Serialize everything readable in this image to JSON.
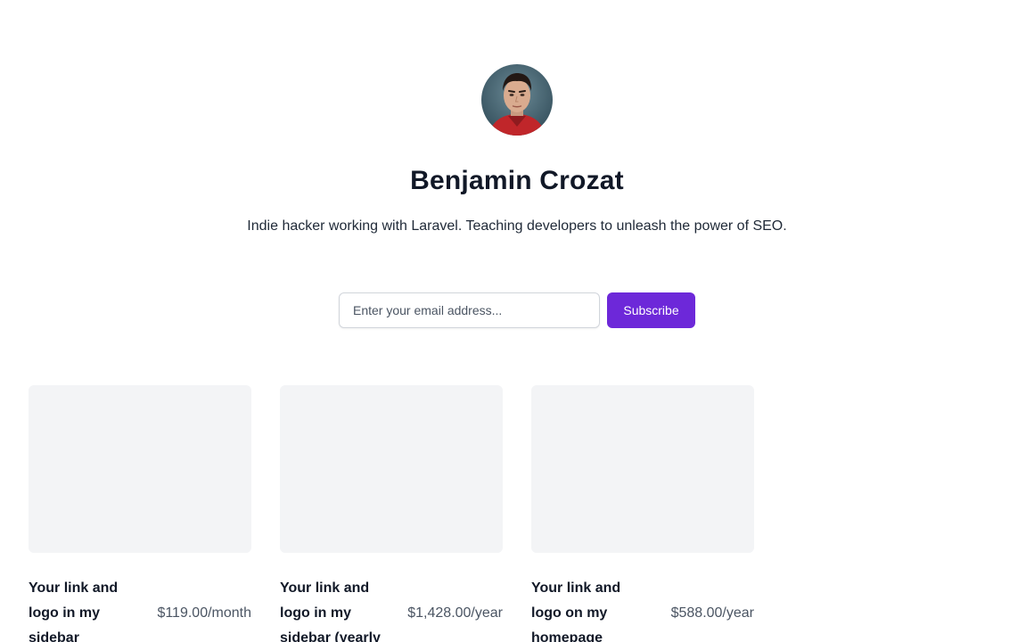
{
  "profile": {
    "name": "Benjamin Crozat",
    "bio": "Indie hacker working with Laravel. Teaching developers to unleash the power of SEO."
  },
  "newsletter": {
    "email_placeholder": "Enter your email address...",
    "email_value": "",
    "subscribe_label": "Subscribe",
    "accent_color": "#6d28d9"
  },
  "products": [
    {
      "title": "Your link and logo in my sidebar",
      "price": "$119.00/month"
    },
    {
      "title": "Your link and logo in my sidebar (yearly",
      "price": "$1,428.00/year"
    },
    {
      "title": "Your link and logo on my homepage",
      "price": "$588.00/year"
    }
  ]
}
